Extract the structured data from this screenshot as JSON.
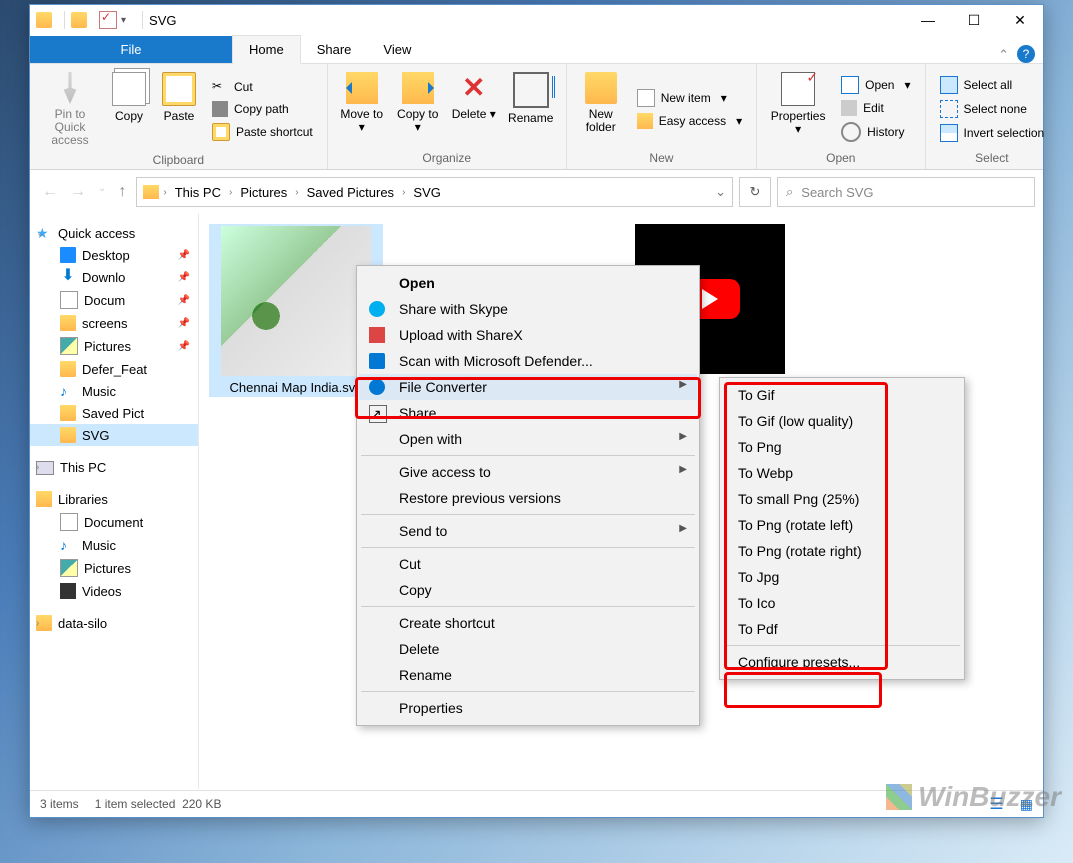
{
  "window": {
    "title": "SVG"
  },
  "tabs": {
    "file": "File",
    "home": "Home",
    "share": "Share",
    "view": "View"
  },
  "ribbon": {
    "clipboard": {
      "label": "Clipboard",
      "pin": "Pin to Quick access",
      "copy": "Copy",
      "paste": "Paste",
      "cut": "Cut",
      "copyPath": "Copy path",
      "pasteShortcut": "Paste shortcut"
    },
    "organize": {
      "label": "Organize",
      "moveTo": "Move to",
      "copyTo": "Copy to",
      "delete": "Delete",
      "rename": "Rename"
    },
    "new": {
      "label": "New",
      "newFolder": "New folder",
      "newItem": "New item",
      "easyAccess": "Easy access"
    },
    "open": {
      "label": "Open",
      "properties": "Properties",
      "open": "Open",
      "edit": "Edit",
      "history": "History"
    },
    "select": {
      "label": "Select",
      "selectAll": "Select all",
      "selectNone": "Select none",
      "invert": "Invert selection"
    }
  },
  "breadcrumb": [
    "This PC",
    "Pictures",
    "Saved Pictures",
    "SVG"
  ],
  "search": {
    "placeholder": "Search SVG"
  },
  "sidebar": {
    "quickAccess": "Quick access",
    "qa": [
      "Desktop",
      "Downlo",
      "Docum",
      "screens",
      "Pictures"
    ],
    "folders": [
      "Defer_Feat",
      "Music",
      "Saved Pict",
      "SVG"
    ],
    "thisPC": "This PC",
    "libraries": "Libraries",
    "libs": [
      "Document",
      "Music",
      "Pictures",
      "Videos"
    ],
    "dataSilo": "data-silo"
  },
  "files": [
    {
      "name": "Chennai Map India.svg",
      "selected": true
    }
  ],
  "contextMenu": {
    "open": "Open",
    "skype": "Share with Skype",
    "sharex": "Upload with ShareX",
    "defender": "Scan with Microsoft Defender...",
    "converter": "File Converter",
    "share": "Share",
    "openWith": "Open with",
    "giveAccess": "Give access to",
    "restore": "Restore previous versions",
    "sendTo": "Send to",
    "cut": "Cut",
    "copy": "Copy",
    "shortcut": "Create shortcut",
    "delete": "Delete",
    "rename": "Rename",
    "properties": "Properties"
  },
  "submenu": {
    "items": [
      "To Gif",
      "To Gif (low quality)",
      "To Png",
      "To Webp",
      "To small Png (25%)",
      "To Png (rotate left)",
      "To Png (rotate right)",
      "To Jpg",
      "To Ico",
      "To Pdf"
    ],
    "configure": "Configure presets..."
  },
  "status": {
    "count": "3 items",
    "selected": "1 item selected",
    "size": "220 KB"
  },
  "watermark": "WinBuzzer"
}
